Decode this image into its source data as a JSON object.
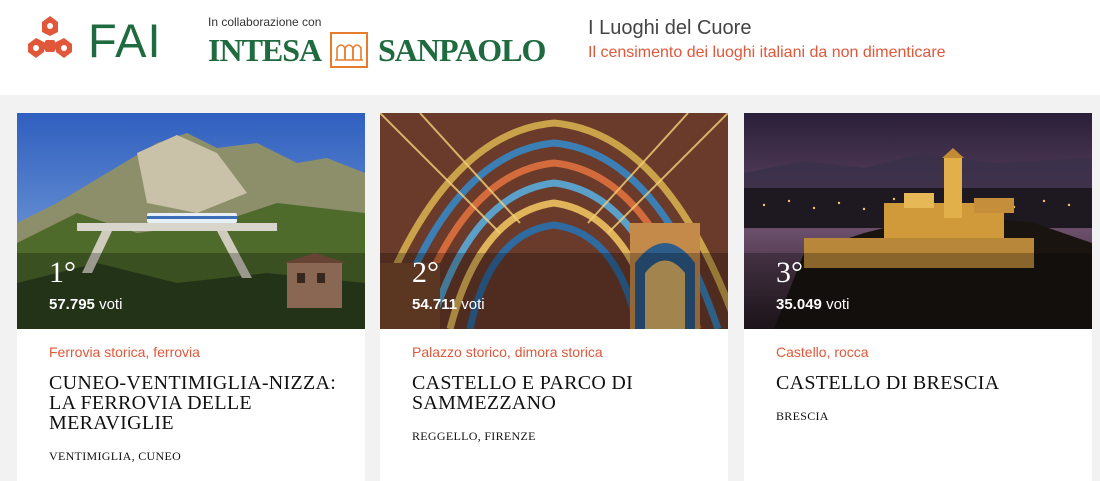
{
  "header": {
    "logo_text": "FAI",
    "collab_label": "In collaborazione con",
    "partner_left": "INTESA",
    "partner_right": "SANPAOLO",
    "title": "I Luoghi del Cuore",
    "subtitle": "Il censimento dei luoghi italiani da non dimenticare"
  },
  "colors": {
    "accent": "#e0573a",
    "brand_green": "#1f6a3f",
    "partner_orange": "#e57d2d"
  },
  "cards": [
    {
      "rank": "1°",
      "votes_number": "57.795",
      "votes_label": "voti",
      "category": "Ferrovia storica, ferrovia",
      "name": "CUNEO-VENTIMIGLIA-NIZZA: LA FERROVIA DELLE MERAVIGLIE",
      "location": "VENTIMIGLIA, CUNEO"
    },
    {
      "rank": "2°",
      "votes_number": "54.711",
      "votes_label": "voti",
      "category": "Palazzo storico, dimora storica",
      "name": "CASTELLO E PARCO DI SAMMEZZANO",
      "location": "REGGELLO, FIRENZE"
    },
    {
      "rank": "3°",
      "votes_number": "35.049",
      "votes_label": "voti",
      "category": "Castello, rocca",
      "name": "CASTELLO DI BRESCIA",
      "location": "BRESCIA"
    }
  ]
}
